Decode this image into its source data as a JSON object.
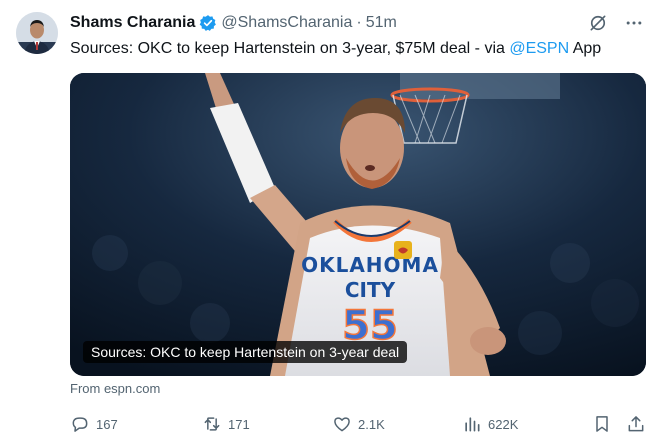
{
  "author": {
    "name": "Shams Charania",
    "handle": "@ShamsCharania",
    "separator": "·",
    "time": "51m"
  },
  "tweet": {
    "text_before": "Sources: OKC to keep Hartenstein on 3-year, $75M deal - via ",
    "mention": "@ESPN",
    "text_after": " App"
  },
  "media": {
    "caption": "Sources: OKC to keep Hartenstein on 3-year deal",
    "jersey_line1": "OKLAHOMA",
    "jersey_line2": "CITY",
    "jersey_number": "55"
  },
  "card": {
    "source": "From espn.com"
  },
  "actions": {
    "replies": "167",
    "reposts": "171",
    "likes": "2.1K",
    "views": "622K"
  },
  "colors": {
    "accent": "#1d9bf0",
    "text": "#0f1419",
    "muted": "#536471"
  }
}
